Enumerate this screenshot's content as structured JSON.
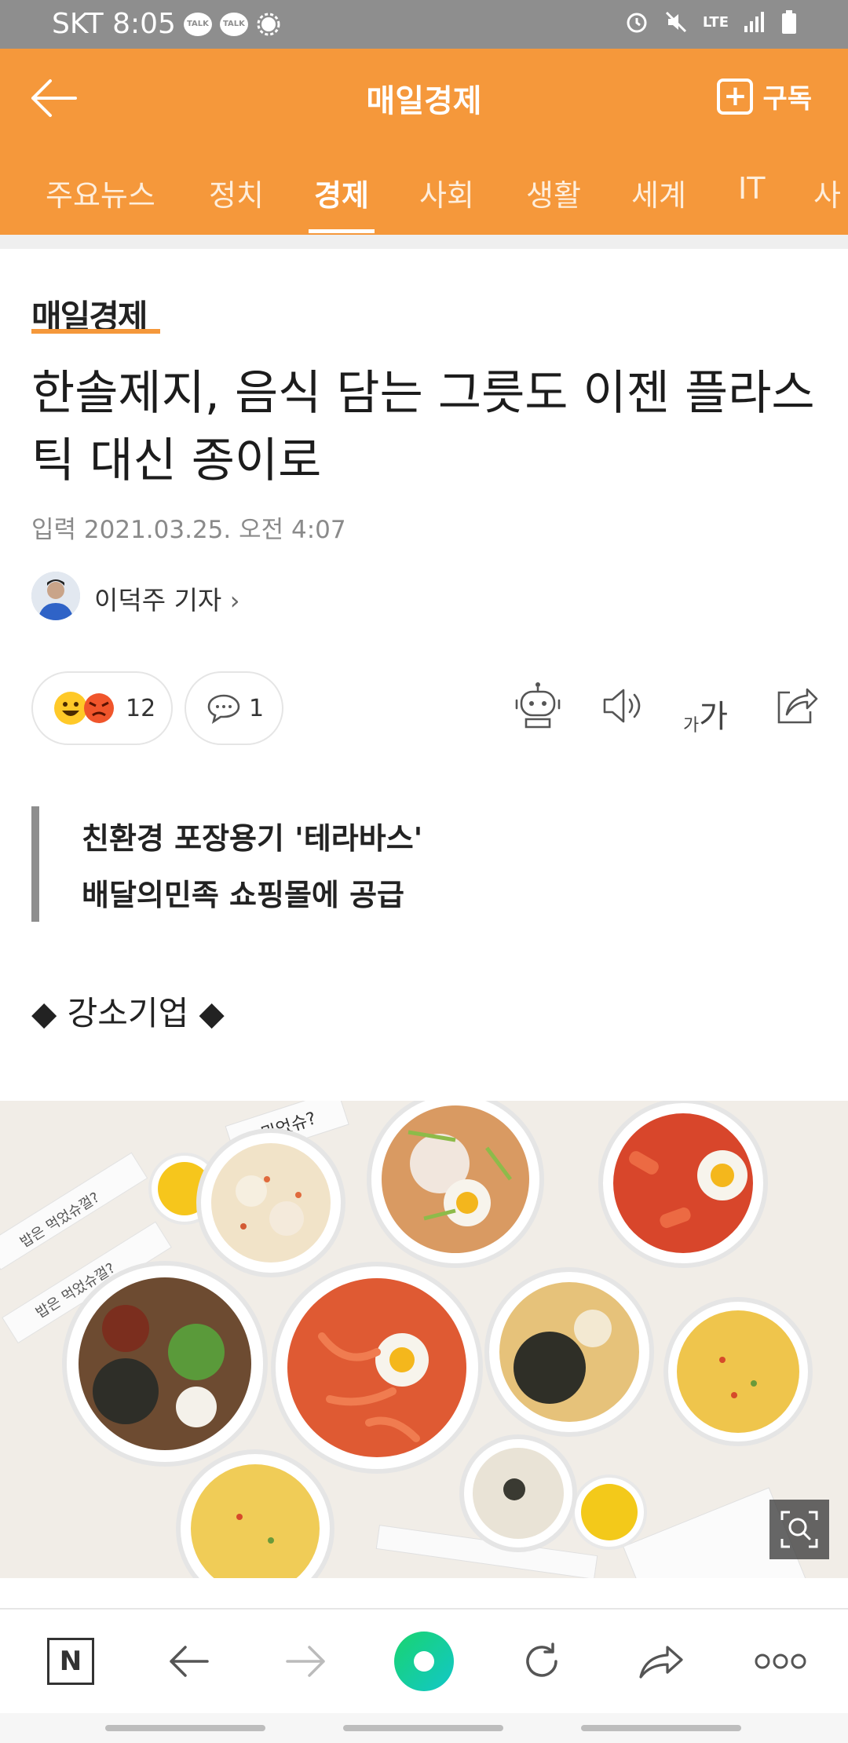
{
  "status_bar": {
    "carrier_time": "SKT 8:05",
    "talk_label": "TALK",
    "network": "LTE"
  },
  "header": {
    "title": "매일경제",
    "subscribe_label": "구독"
  },
  "tabs": [
    "주요뉴스",
    "정치",
    "경제",
    "사회",
    "생활",
    "세계",
    "IT",
    "사"
  ],
  "active_tab": "경제",
  "article": {
    "press_name": "매일경제",
    "headline": "한솔제지, 음식 담는 그릇도 이젠 플라스틱 대신 종이로",
    "date": "입력 2021.03.25. 오전 4:07",
    "reporter": "이덕주 기자",
    "reaction_count": "12",
    "comment_count": "1",
    "font_size_label_small": "가",
    "font_size_label_large": "가",
    "summary_lines": [
      "친환경 포장용기 '테라바스'",
      "배달의민족 쇼핑몰에 공급"
    ],
    "section_heading": "◆ 강소기업 ◆",
    "photo_texts": [
      "뭐었슈?",
      "밥은 먹었슈껄?",
      "밥은 먹었슈껄?"
    ]
  },
  "bottom_nav": {
    "naver_label": "N"
  },
  "colors": {
    "accent": "#f5983b",
    "status_bar": "#8e8e8e",
    "green": "#1ec98a"
  },
  "icons": [
    "back-arrow-icon",
    "plus-icon",
    "robot-icon",
    "speaker-icon",
    "share-icon",
    "zoom-icon",
    "refresh-icon",
    "more-icon"
  ]
}
